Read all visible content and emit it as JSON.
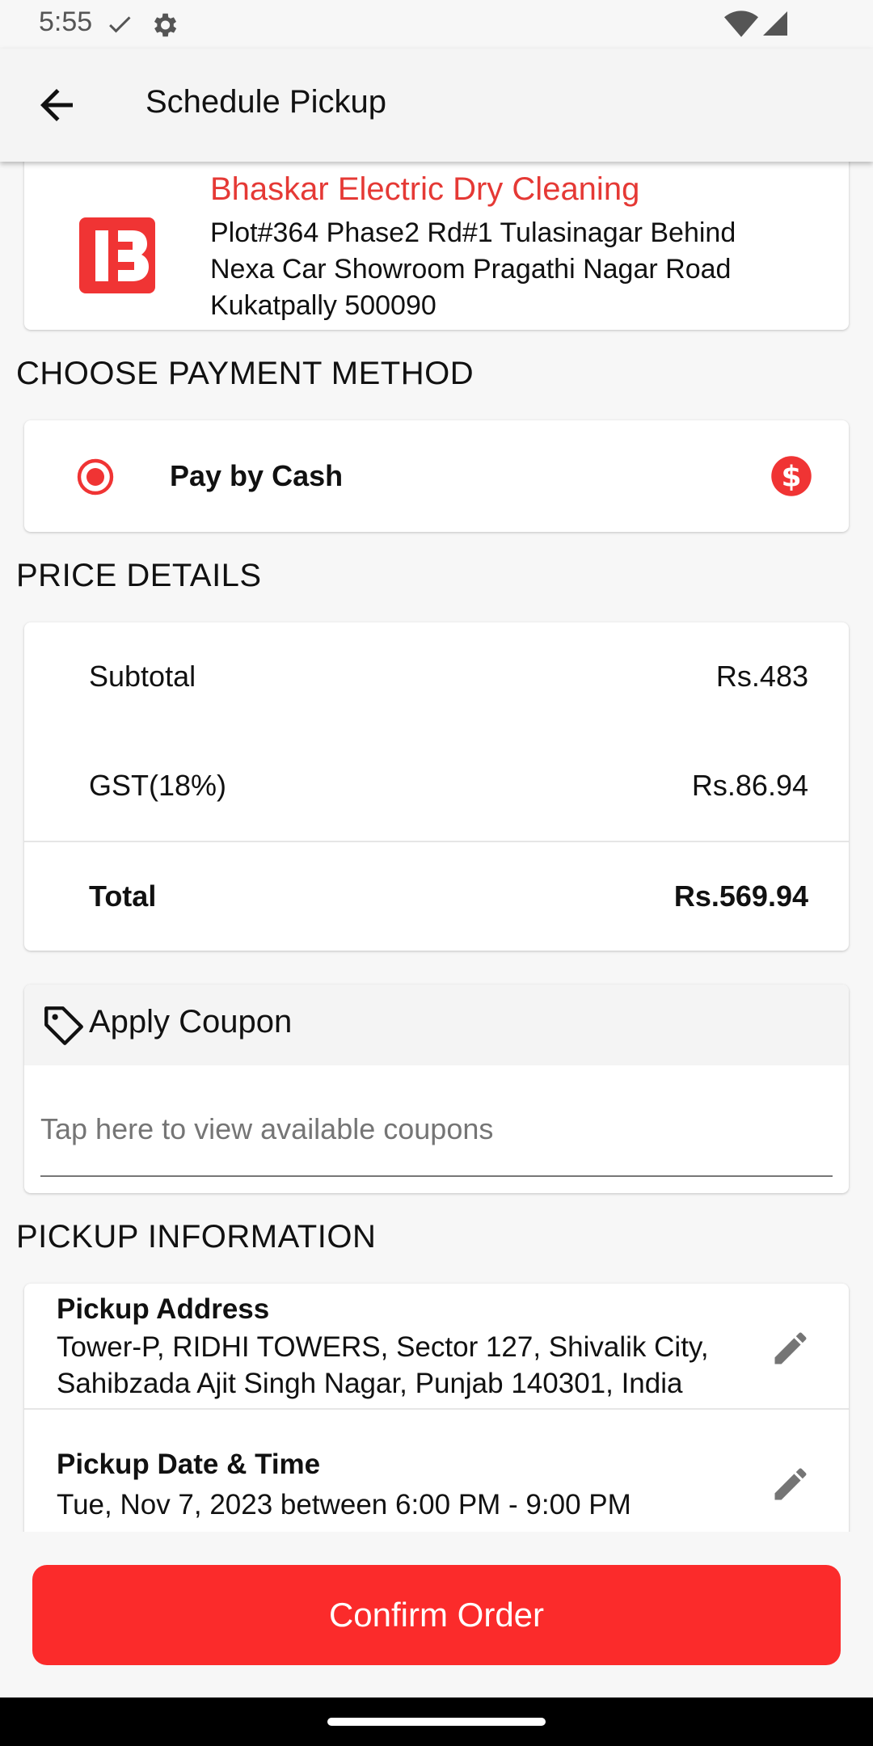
{
  "status_bar": {
    "time": "5:55"
  },
  "app_bar": {
    "title": "Schedule Pickup"
  },
  "store": {
    "name": "Bhaskar Electric Dry Cleaning",
    "address_lines": [
      "Plot#364 Phase2 Rd#1 Tulasinagar Behind",
      "Nexa Car Showroom Pragathi Nagar Road",
      "Kukatpally 500090"
    ]
  },
  "payment": {
    "section_title": "CHOOSE PAYMENT METHOD",
    "option_label": "Pay by Cash"
  },
  "price": {
    "section_title": "PRICE DETAILS",
    "subtotal_label": "Subtotal",
    "subtotal_value": "Rs.483",
    "gst_label": "GST(18%)",
    "gst_value": "Rs.86.94",
    "total_label": "Total",
    "total_value": "Rs.569.94"
  },
  "coupon": {
    "title": "Apply Coupon",
    "placeholder": "Tap here to view available coupons"
  },
  "pickup": {
    "section_title": "PICKUP INFORMATION",
    "address_label": "Pickup Address",
    "address_lines": [
      "Tower-P, RIDHI TOWERS, Sector 127, Shivalik City,",
      "Sahibzada Ajit Singh Nagar, Punjab 140301, India"
    ],
    "datetime_label": "Pickup Date & Time",
    "datetime_value": "Tue, Nov 7, 2023 between 6:00 PM - 9:00 PM"
  },
  "confirm_button_label": "Confirm Order",
  "colors": {
    "accent": "#fb2b2b",
    "store_name": "#e53935"
  },
  "icons": [
    "check-icon",
    "settings-icon",
    "wifi-icon",
    "signal-icon",
    "back-arrow-icon",
    "store-logo-icon",
    "radio-selected-icon",
    "dollar-icon",
    "tag-icon",
    "edit-icon"
  ]
}
